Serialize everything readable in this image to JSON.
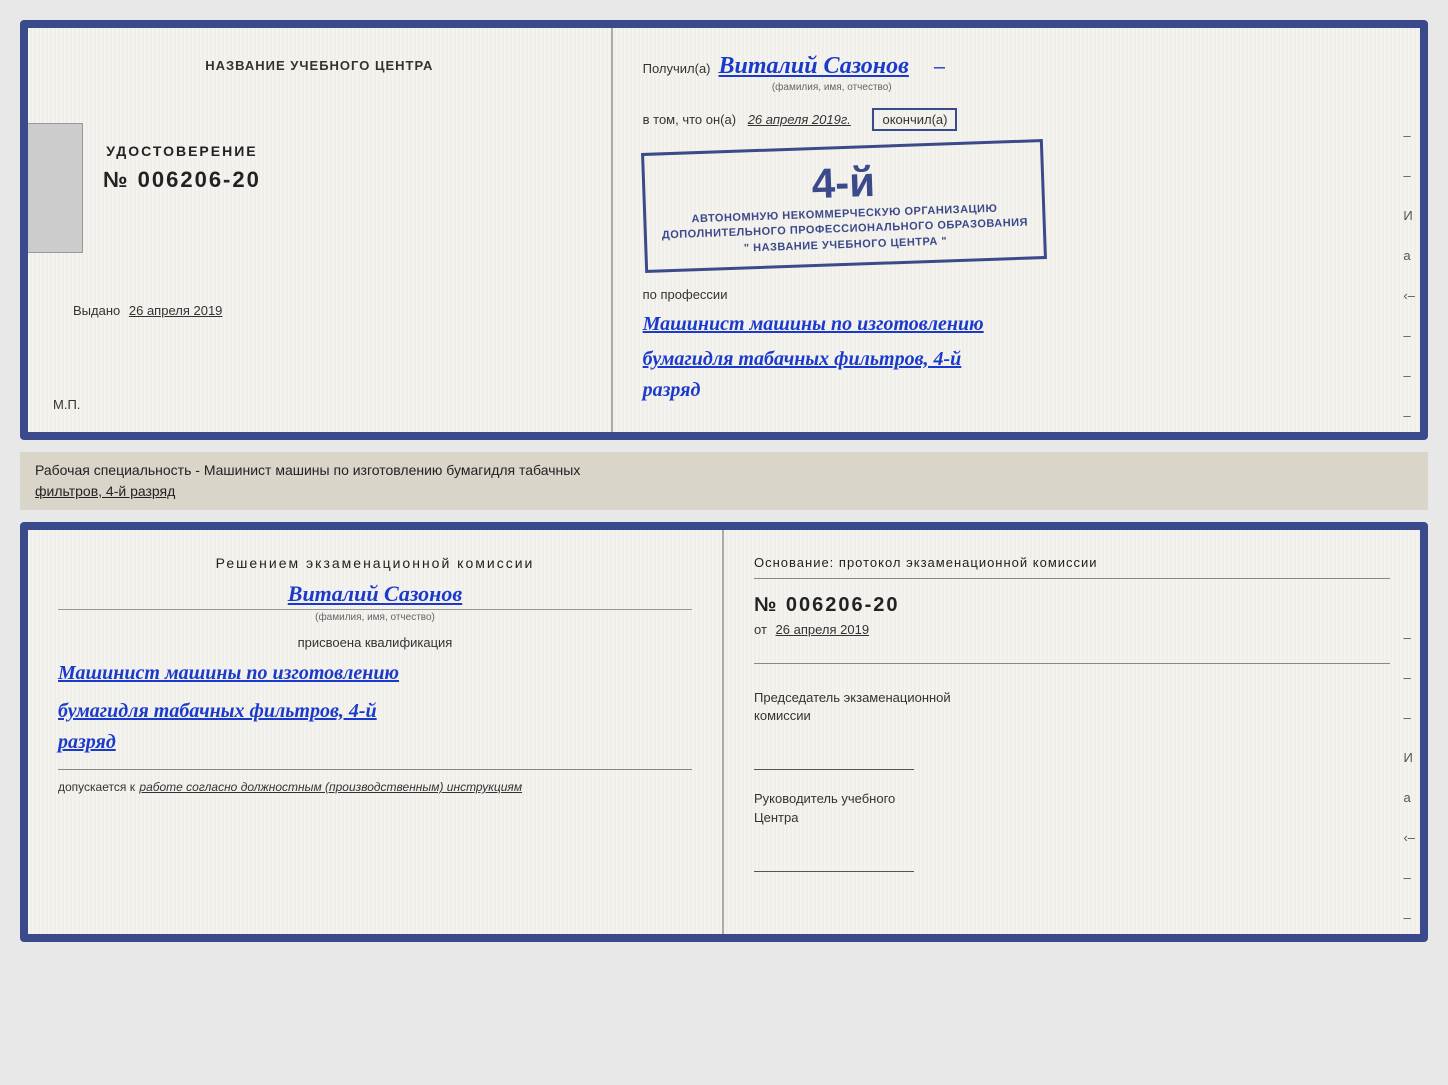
{
  "page": {
    "background_color": "#e8e8e8"
  },
  "top_document": {
    "left": {
      "title": "НАЗВАНИЕ УЧЕБНОГО ЦЕНТРА",
      "cert_label": "УДОСТОВЕРЕНИЕ",
      "cert_number": "№ 006206-20",
      "issued_text": "Выдано",
      "issued_date": "26 апреля 2019",
      "mp_label": "М.П."
    },
    "right": {
      "poluchil_prefix": "Получил(а)",
      "recipient_name": "Виталий Сазонов",
      "fio_subtitle": "(фамилия, имя, отчество)",
      "dash1": "–",
      "vtom_prefix": "в том, что он(а)",
      "vtom_date": "26 апреля 2019г.",
      "okonchill": "окончил(а)",
      "stamp_line1": "АВТОНОМНУЮ НЕКОММЕРЧЕСКУЮ ОРГАНИЗАЦИЮ",
      "stamp_line2": "ДОПОЛНИТЕЛЬНОГО ПРОФЕССИОНАЛЬНОГО ОБРАЗОВАНИЯ",
      "stamp_line3": "\" НАЗВАНИЕ УЧЕБНОГО ЦЕНТРА \"",
      "stamp_number": "4-й",
      "profession_label": "по профессии",
      "profession_line1": "Машинист машины по изготовлению",
      "profession_line2": "бумагидля табачных фильтров, 4-й",
      "razryad": "разряд",
      "side_dashes": [
        "–",
        "–",
        "И",
        "а",
        "‹–",
        "–",
        "–",
        "–",
        "–"
      ]
    }
  },
  "middle_label": {
    "text_normal": "Рабочая специальность - Машинист машины по изготовлению бумагидля табачных",
    "text_underline": "фильтров, 4-й разряд"
  },
  "bottom_document": {
    "left": {
      "decision_title": "Решением  экзаменационной  комиссии",
      "person_name": "Виталий Сазонов",
      "fio_subtitle": "(фамилия, имя, отчество)",
      "prisvoena_label": "присвоена квалификация",
      "kvalif_line1": "Машинист машины по изготовлению",
      "kvalif_line2": "бумагидля табачных фильтров, 4-й",
      "razryad": "разряд",
      "dopusk_prefix": "допускается к",
      "dopusk_text": "работе согласно должностным (производственным) инструкциям"
    },
    "right": {
      "osnov_title": "Основание:  протокол  экзаменационной  комиссии",
      "protokol_number": "№  006206-20",
      "ot_prefix": "от",
      "ot_date": "26 апреля 2019",
      "chairman_label": "Председатель экзаменационной\nкомиссии",
      "rukov_label": "Руководитель учебного\nЦентра",
      "side_dashes": [
        "–",
        "–",
        "–",
        "И",
        "а",
        "‹–",
        "–",
        "–",
        "–",
        "–"
      ]
    }
  }
}
